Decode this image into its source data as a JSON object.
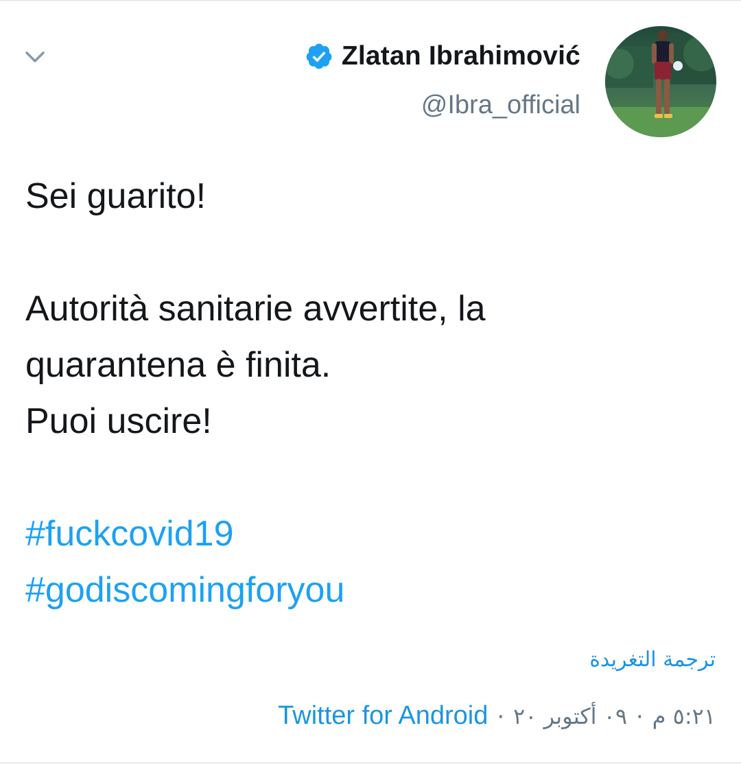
{
  "tweet": {
    "author": {
      "display_name": "Zlatan Ibrahimović",
      "handle": "@Ibra_official",
      "verified_icon": "verified-badge-icon",
      "avatar_icon": "profile-photo"
    },
    "menu_icon": "chevron-down-icon",
    "body": {
      "line1": "Sei guarito!",
      "line2": "Autorità sanitarie avvertite, la",
      "line3": "quarantena è finita.",
      "line4": "Puoi uscire!",
      "hashtag1": "#fuckcovid19",
      "hashtag2": "#godiscomingforyou"
    },
    "translate_label": "ترجمة التغريدة",
    "meta": {
      "time": "٥:٢١ م",
      "date": "٠٩ أكتوبر ٢٠",
      "separator": "·",
      "source": "Twitter for Android"
    }
  },
  "colors": {
    "accent": "#1da1f2",
    "link": "#1b95e0",
    "text": "#14171a",
    "secondary": "#657786",
    "divider": "#e6ecf0"
  }
}
